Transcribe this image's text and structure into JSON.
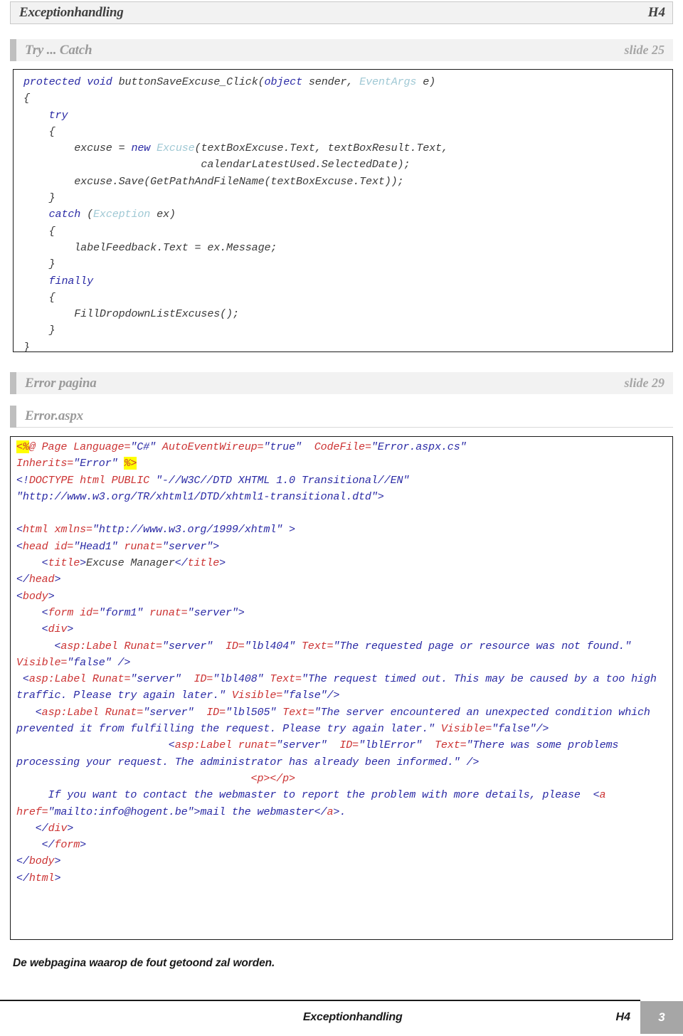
{
  "header": {
    "title": "Exceptionhandling",
    "chapter": "H4"
  },
  "sections": [
    {
      "title": "Try ... Catch",
      "slide": "slide 25"
    },
    {
      "title": "Error pagina",
      "slide": "slide 29"
    }
  ],
  "subheader": {
    "title": "Error.aspx"
  },
  "code_csharp": {
    "lines": [
      "protected void buttonSaveExcuse_Click(object sender, EventArgs e)",
      "{",
      "    try",
      "    {",
      "        excuse = new Excuse(textBoxExcuse.Text, textBoxResult.Text,",
      "                            calendarLatestUsed.SelectedDate);",
      "        excuse.Save(GetPathAndFileName(textBoxExcuse.Text));",
      "    }",
      "    catch (Exception ex)",
      "    {",
      "        labelFeedback.Text = ex.Message;",
      "    }",
      "    finally",
      "    {",
      "        FillDropdownListExcuses();",
      "    }",
      "}"
    ]
  },
  "code_aspx": {
    "lines": [
      "<%@ Page Language=\"C#\" AutoEventWireup=\"true\"  CodeFile=\"Error.aspx.cs\"",
      "Inherits=\"Error\" %>",
      "<!DOCTYPE html PUBLIC \"-//W3C//DTD XHTML 1.0 Transitional//EN\"",
      "\"http://www.w3.org/TR/xhtml1/DTD/xhtml1-transitional.dtd\">",
      "",
      "<html xmlns=\"http://www.w3.org/1999/xhtml\" >",
      "<head id=\"Head1\" runat=\"server\">",
      "    <title>Excuse Manager</title>",
      "</head>",
      "<body>",
      "    <form id=\"form1\" runat=\"server\">",
      "    <div>",
      "      <asp:Label Runat=\"server\"  ID=\"lbl404\" Text=\"The requested page or resource was not found.\" Visible=\"false\" />",
      " <asp:Label Runat=\"server\"  ID=\"lbl408\" Text=\"The request timed out. This may be caused by a too high traffic. Please try again later.\" Visible=\"false\"/>",
      "   <asp:Label Runat=\"server\"  ID=\"lbl505\" Text=\"The server encountered an unexpected condition which prevented it from fulfilling the request. Please try again later.\" Visible=\"false\"/>",
      "                       <asp:Label runat=\"server\"  ID=\"lblError\"  Text=\"There was some problems processing your request. The administrator has already been informed.\" />",
      "                               <p></p>",
      "     If you want to contact the webmaster to report the problem with more details, please  <a href=\"mailto:info@hogent.be\">mail the webmaster</a>.",
      "   </div>",
      "    </form>",
      "</body>",
      "</html>"
    ]
  },
  "caption": {
    "text": "De webpagina waarop de fout getoond zal worden."
  },
  "footer": {
    "title": "Exceptionhandling",
    "chapter": "H4",
    "page": "3"
  },
  "colors": {
    "keyword": "#2a2aa5",
    "type": "#9fc8d4",
    "tag": "#cc3333",
    "attr_value": "#2a2aa5",
    "highlight": "#ffff00",
    "band_gray": "#f2f2f2",
    "bar_gray": "#bfbfbf",
    "footer_page_bg": "#a6a6a6"
  }
}
